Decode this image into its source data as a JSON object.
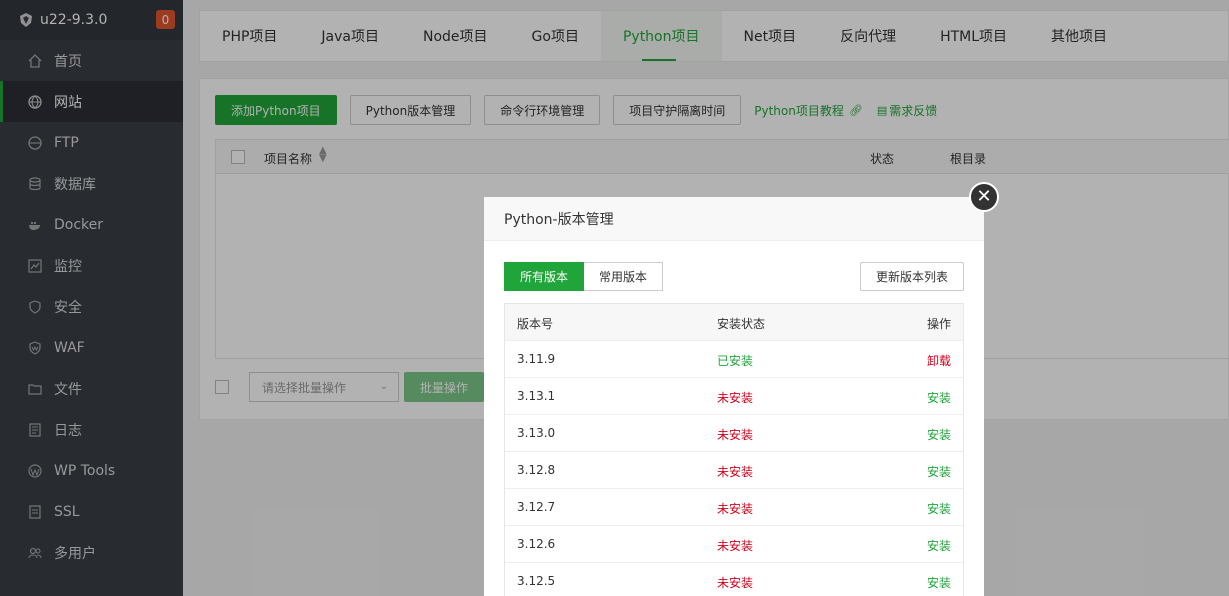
{
  "sidebar": {
    "brand": "u22-9.3.0",
    "badge": "0",
    "items": [
      {
        "label": "首页",
        "icon": "home-icon"
      },
      {
        "label": "网站",
        "icon": "globe-icon"
      },
      {
        "label": "FTP",
        "icon": "ftp-icon"
      },
      {
        "label": "数据库",
        "icon": "database-icon"
      },
      {
        "label": "Docker",
        "icon": "docker-icon"
      },
      {
        "label": "监控",
        "icon": "monitor-icon"
      },
      {
        "label": "安全",
        "icon": "shield-icon"
      },
      {
        "label": "WAF",
        "icon": "waf-icon"
      },
      {
        "label": "文件",
        "icon": "folder-icon"
      },
      {
        "label": "日志",
        "icon": "log-icon"
      },
      {
        "label": "WP Tools",
        "icon": "wordpress-icon"
      },
      {
        "label": "SSL",
        "icon": "ssl-icon"
      },
      {
        "label": "多用户",
        "icon": "users-icon"
      }
    ]
  },
  "tabs": [
    "PHP项目",
    "Java项目",
    "Node项目",
    "Go项目",
    "Python项目",
    "Net项目",
    "反向代理",
    "HTML项目",
    "其他项目"
  ],
  "toolbar": {
    "add": "添加Python项目",
    "version_mgmt": "Python版本管理",
    "cmd_env": "命令行环境管理",
    "guard": "项目守护隔离时间",
    "tutorial": "Python项目教程",
    "feedback": "需求反馈"
  },
  "grid": {
    "col_name": "项目名称",
    "col_status": "状态",
    "col_root": "根目录"
  },
  "footer": {
    "batch_placeholder": "请选择批量操作",
    "batch_btn": "批量操作"
  },
  "modal": {
    "title": "Python-版本管理",
    "seg_all": "所有版本",
    "seg_common": "常用版本",
    "refresh": "更新版本列表",
    "headers": {
      "version": "版本号",
      "status": "安装状态",
      "action": "操作"
    },
    "rows": [
      {
        "version": "3.11.9",
        "status": "已安装",
        "action": "卸载"
      },
      {
        "version": "3.13.1",
        "status": "未安装",
        "action": "安装"
      },
      {
        "version": "3.13.0",
        "status": "未安装",
        "action": "安装"
      },
      {
        "version": "3.12.8",
        "status": "未安装",
        "action": "安装"
      },
      {
        "version": "3.12.7",
        "status": "未安装",
        "action": "安装"
      },
      {
        "version": "3.12.6",
        "status": "未安装",
        "action": "安装"
      },
      {
        "version": "3.12.5",
        "status": "未安装",
        "action": "安装"
      }
    ]
  },
  "colors": {
    "accent": "#20a53a",
    "danger": "#d0021b",
    "sidebar_bg": "#3a3e45"
  }
}
